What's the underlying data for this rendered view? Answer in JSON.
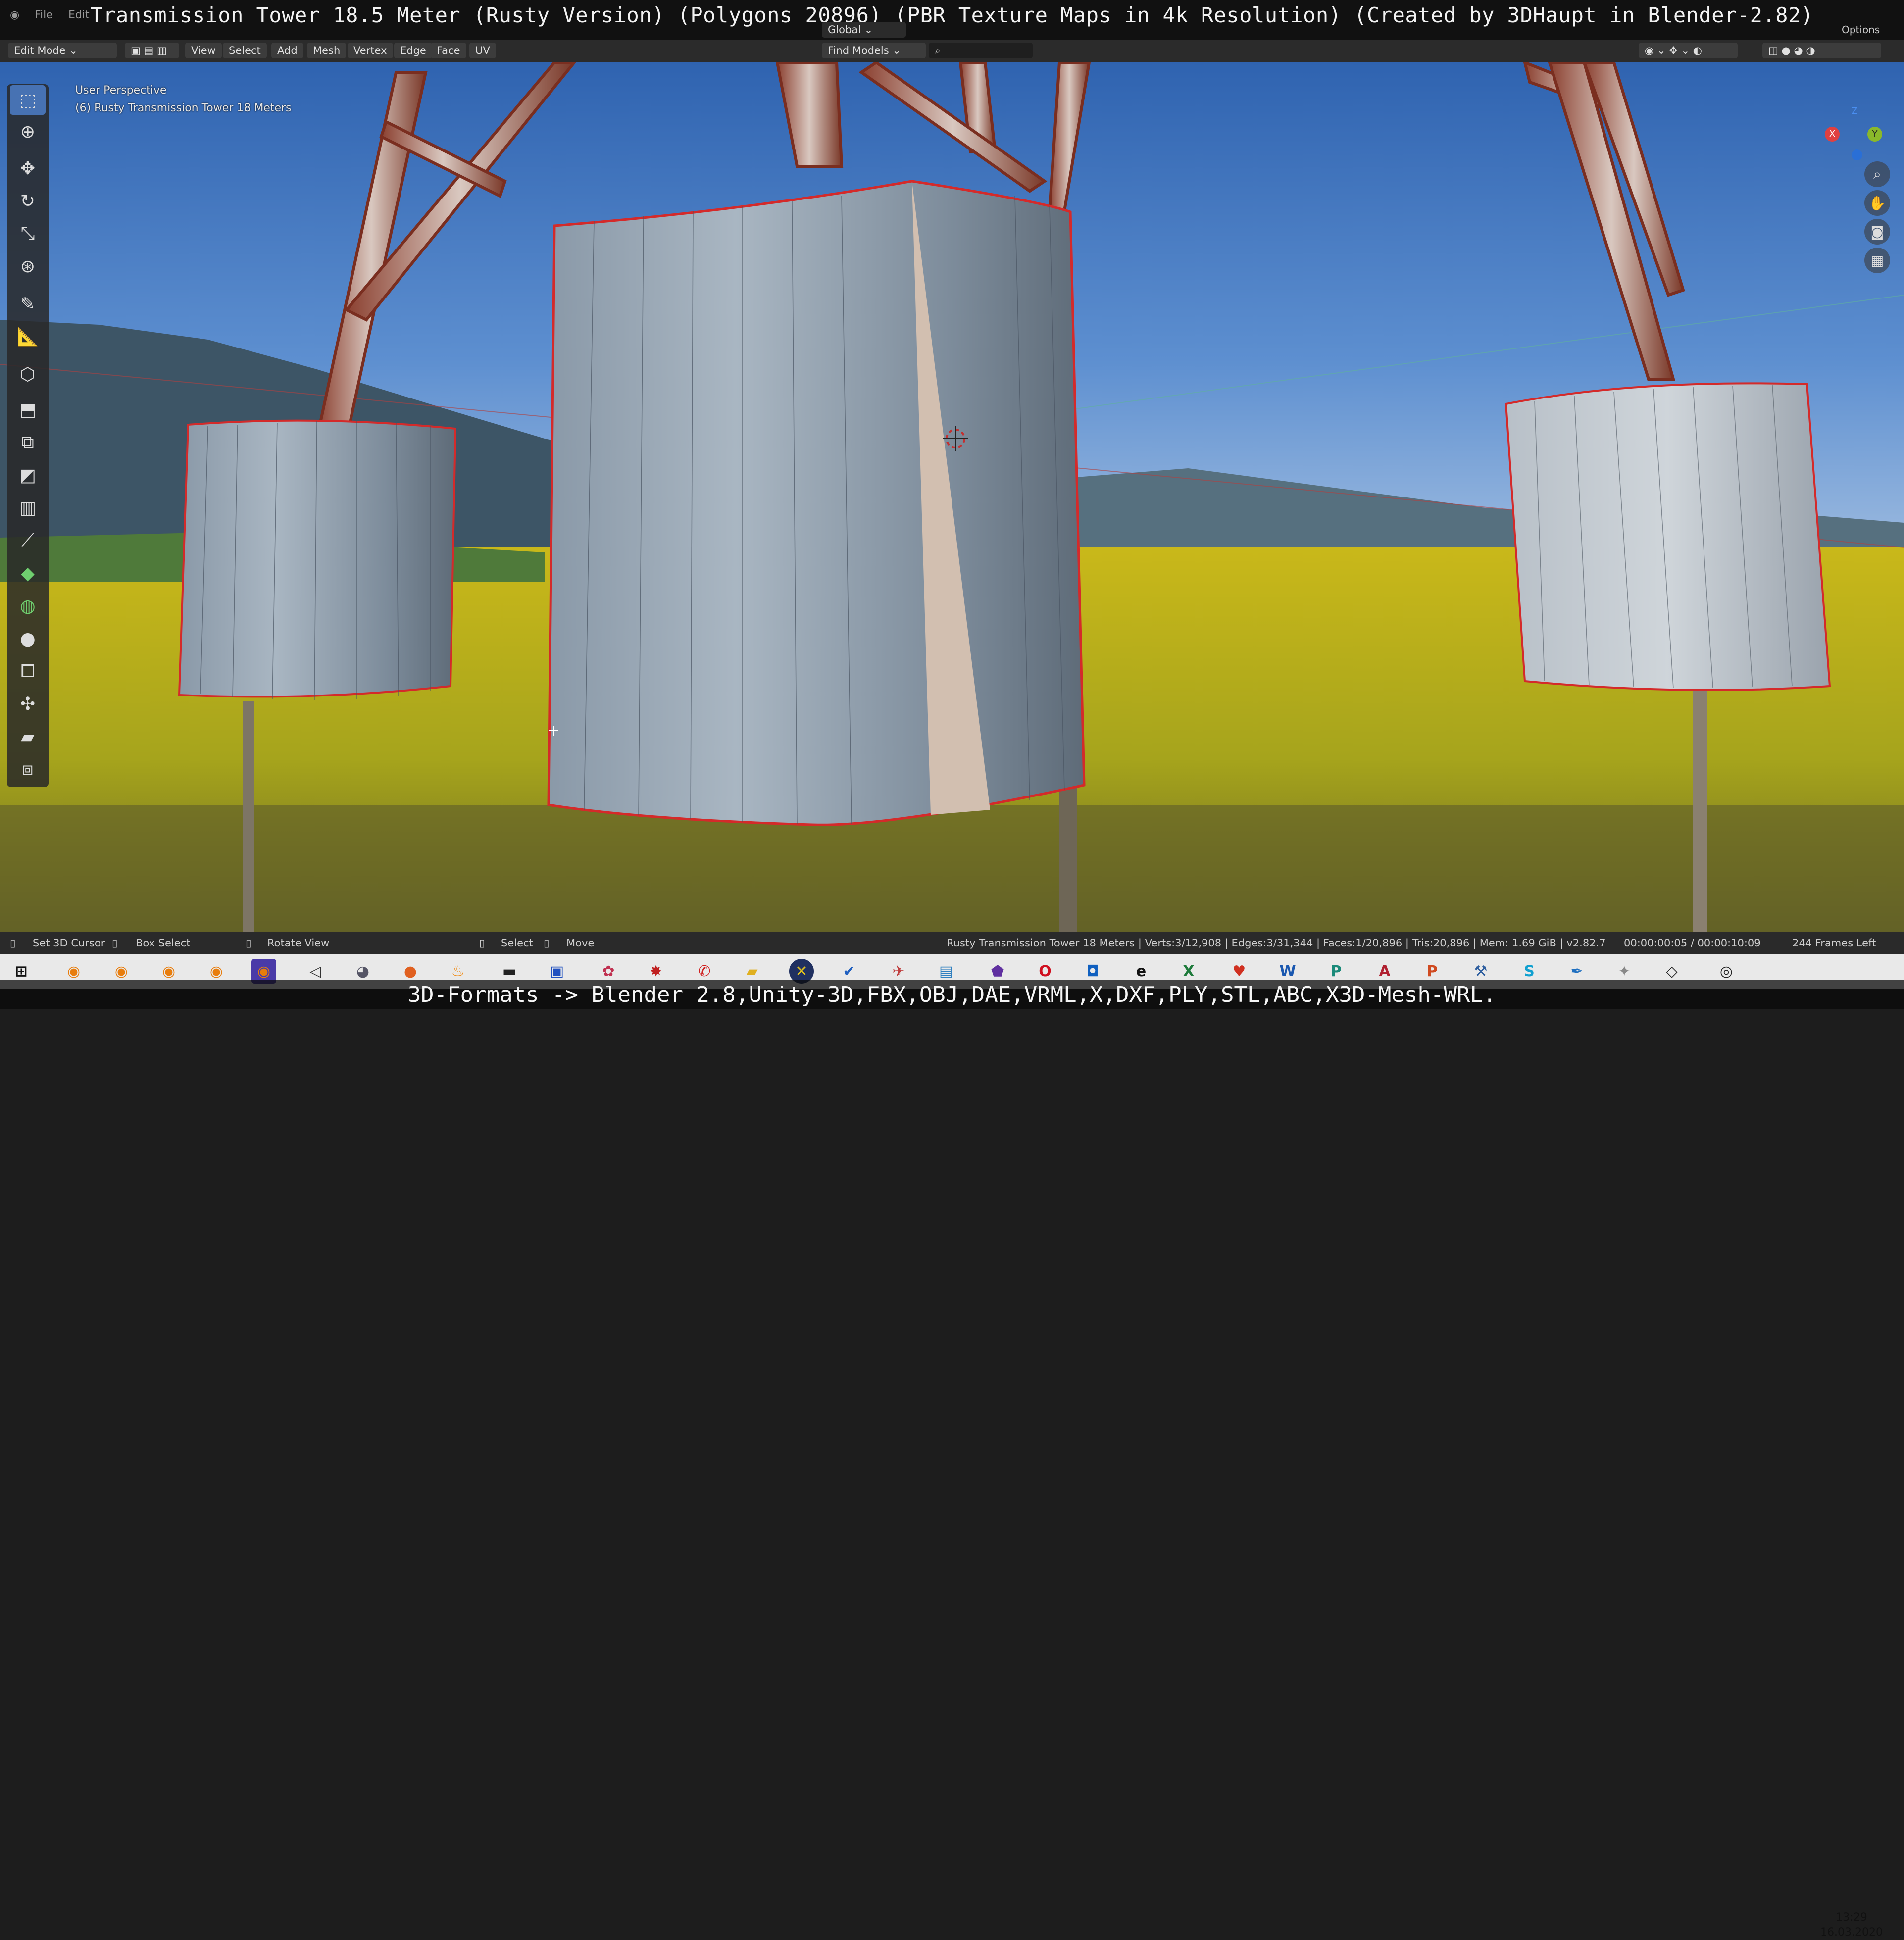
{
  "caption_top": "Transmission Tower 18.5 Meter (Rusty Version) (Polygons 20896) (PBR Texture Maps in 4k Resolution) (Created by 3DHaupt in Blender-2.82)",
  "caption_bottom": "3D-Formats -> Blender 2.8,Unity-3D,FBX,OBJ,DAE,VRML,X,DXF,PLY,STL,ABC,X3D-Mesh-WRL.",
  "top_menu": {
    "file": "File",
    "edit": "Edit",
    "options": "Options"
  },
  "header": {
    "mode": "Edit Mode",
    "menus": [
      "View",
      "Select",
      "Add",
      "Mesh",
      "Vertex",
      "Edge",
      "Face",
      "UV"
    ],
    "orientation": "Global",
    "find_models": "Find Models"
  },
  "viewport": {
    "perspective": "User Perspective",
    "object": "(6) Rusty Transmission Tower 18 Meters",
    "gizmo": {
      "x": "X",
      "y": "Y",
      "z": "Z"
    }
  },
  "tools": [
    {
      "icon": "select-box-icon"
    },
    {
      "icon": "cursor-icon"
    },
    {
      "icon": "move-icon"
    },
    {
      "icon": "rotate-icon"
    },
    {
      "icon": "scale-icon"
    },
    {
      "icon": "transform-icon"
    },
    {
      "icon": "annotate-icon"
    },
    {
      "icon": "measure-icon"
    },
    {
      "icon": "add-cube-icon"
    },
    {
      "icon": "extrude-icon"
    },
    {
      "icon": "inset-icon"
    },
    {
      "icon": "bevel-icon"
    },
    {
      "icon": "loop-cut-icon"
    },
    {
      "icon": "knife-icon"
    },
    {
      "icon": "poly-build-icon"
    },
    {
      "icon": "spin-icon"
    },
    {
      "icon": "smooth-icon"
    },
    {
      "icon": "edge-slide-icon"
    },
    {
      "icon": "shrink-fatten-icon"
    },
    {
      "icon": "shear-icon"
    },
    {
      "icon": "rip-icon"
    }
  ],
  "status": {
    "set_cursor": "Set 3D Cursor",
    "box_select": "Box Select",
    "rotate_view": "Rotate View",
    "select": "Select",
    "move": "Move",
    "stats": "Rusty Transmission Tower 18 Meters | Verts:3/12,908 | Edges:3/31,344 | Faces:1/20,896 | Tris:20,896 | Mem: 1.69 GiB | v2.82.7",
    "timecode": "00:00:00:05 / 00:00:10:09",
    "frames": "244 Frames Left"
  },
  "clock": {
    "time": "13:29",
    "date": "16.03.2020"
  },
  "colors": {
    "accent": "#4772b3",
    "edge": "#d42a2a",
    "sky": "#3a6fb8",
    "field": "#d8c224"
  }
}
